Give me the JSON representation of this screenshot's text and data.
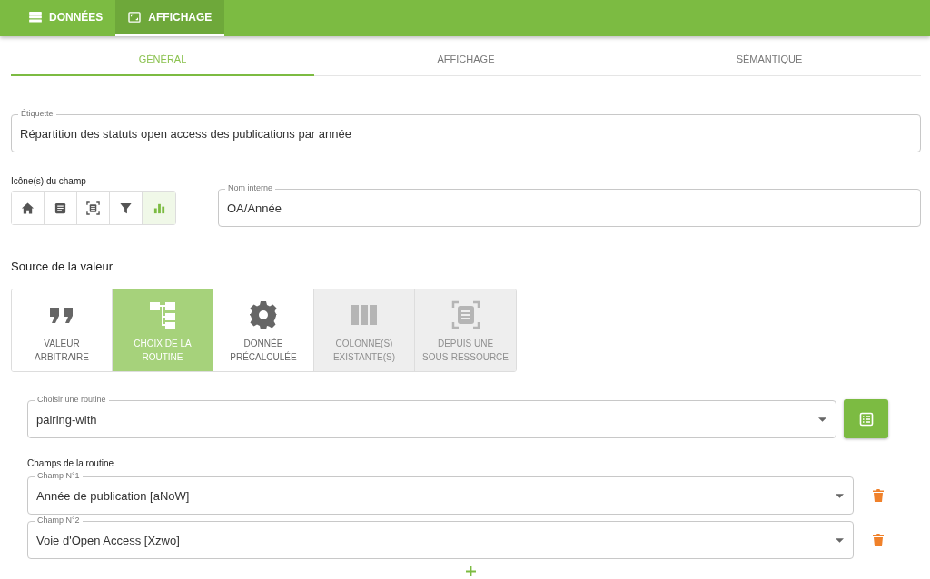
{
  "top_tabs": [
    {
      "label": "DONNÉES",
      "kind": "list",
      "selected": false
    },
    {
      "label": "AFFICHAGE",
      "kind": "frame",
      "selected": true
    }
  ],
  "sub_tabs": [
    {
      "label": "GÉNÉRAL",
      "selected": true
    },
    {
      "label": "AFFICHAGE",
      "selected": false
    },
    {
      "label": "SÉMANTIQUE",
      "selected": false
    }
  ],
  "label_field": {
    "label": "Étiquette",
    "value": "Répartition des statuts open access des publications par année"
  },
  "field_icons": {
    "label": "Icône(s) du champ",
    "items": [
      {
        "kind": "home",
        "selected": false
      },
      {
        "kind": "document",
        "selected": false
      },
      {
        "kind": "frame",
        "selected": false
      },
      {
        "kind": "filter",
        "selected": false
      },
      {
        "kind": "chart",
        "selected": true
      }
    ]
  },
  "internal_name": {
    "label": "Nom interne",
    "value": "OA/Année"
  },
  "value_source": {
    "title": "Source de la valeur",
    "options": [
      {
        "kind": "quote",
        "label_lines": [
          "VALEUR",
          "ARBITRAIRE"
        ],
        "selected": false,
        "disabled": false
      },
      {
        "kind": "tree",
        "label_lines": [
          "CHOIX DE LA",
          "ROUTINE"
        ],
        "selected": true,
        "disabled": false
      },
      {
        "kind": "gear",
        "label_lines": [
          "DONNÉE",
          "PRÉCALCULÉE"
        ],
        "selected": false,
        "disabled": false
      },
      {
        "kind": "columns",
        "label_lines": [
          "COLONNE(S)",
          "EXISTANTE(S)"
        ],
        "selected": false,
        "disabled": true
      },
      {
        "kind": "frame",
        "label_lines": [
          "DEPUIS UNE",
          "SOUS-RESSOURCE"
        ],
        "selected": false,
        "disabled": true
      }
    ]
  },
  "routine": {
    "label": "Choisir une routine",
    "value": "pairing-with"
  },
  "routine_fields": {
    "title": "Champs de la routine",
    "fields": [
      {
        "label": "Champ N°1",
        "value": "Année de publication [aNoW]"
      },
      {
        "label": "Champ N°2",
        "value": "Voie d'Open Access [Xzwo]"
      }
    ]
  }
}
